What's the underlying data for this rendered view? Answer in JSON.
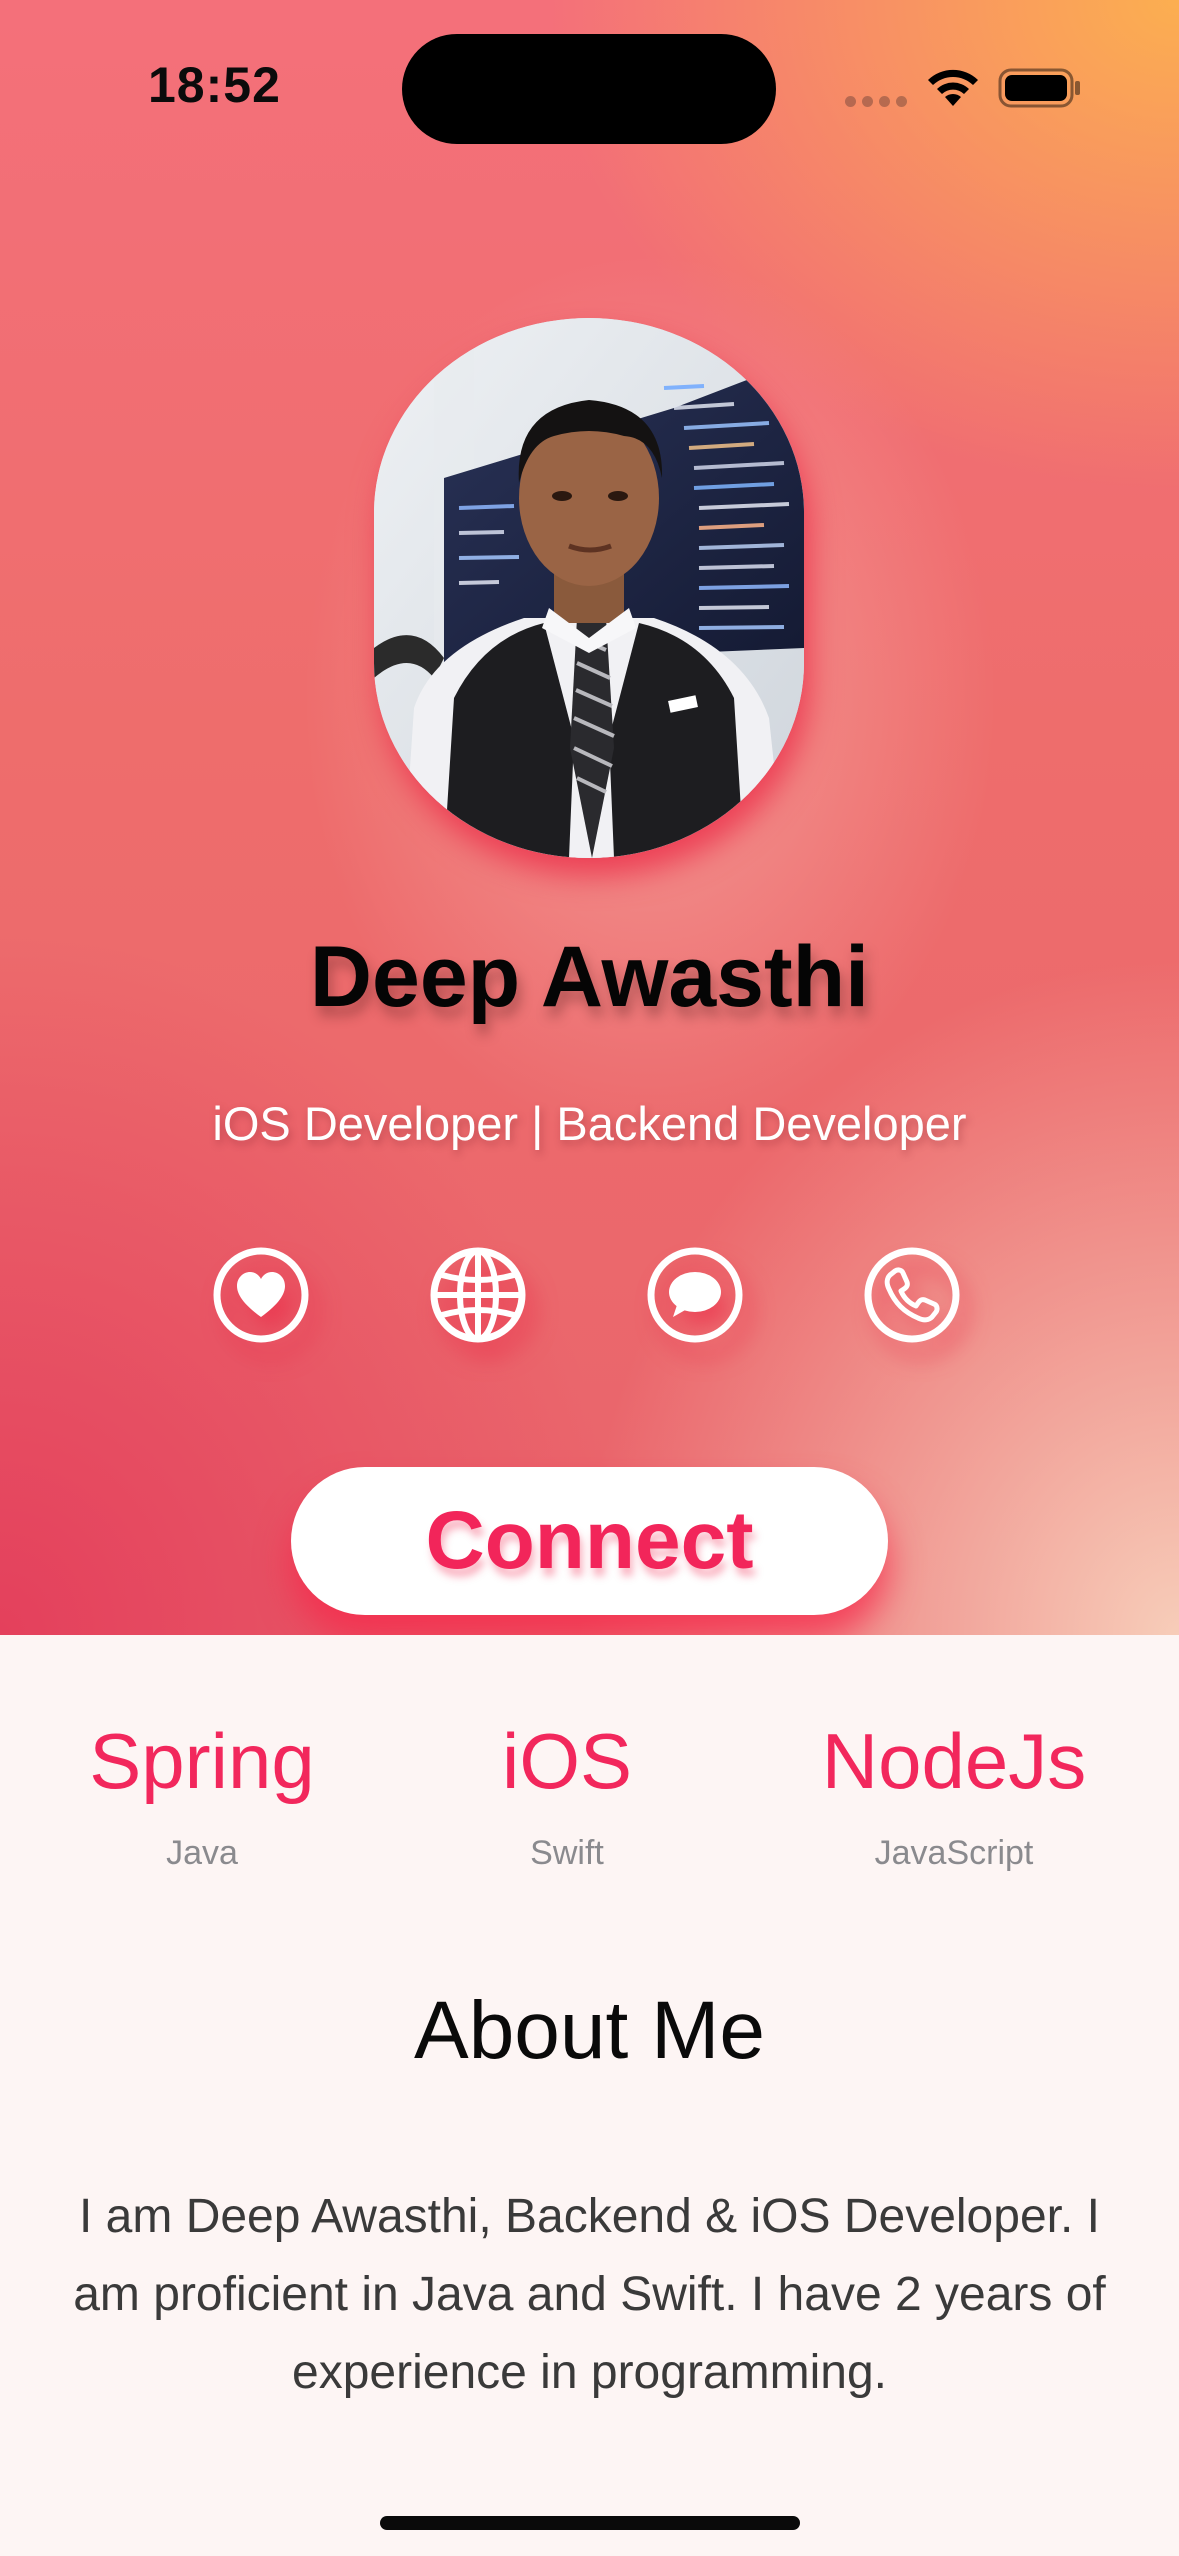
{
  "status_bar": {
    "time": "18:52"
  },
  "profile": {
    "name": "Deep Awasthi",
    "subtitle": "iOS Developer | Backend Developer"
  },
  "actions": {
    "icons": [
      "heart-icon",
      "globe-icon",
      "chat-bubble-icon",
      "phone-icon"
    ]
  },
  "connect_button": {
    "label": "Connect"
  },
  "skills": [
    {
      "name": "Spring",
      "language": "Java"
    },
    {
      "name": "iOS",
      "language": "Swift"
    },
    {
      "name": "NodeJs",
      "language": "JavaScript"
    }
  ],
  "about": {
    "title": "About Me",
    "body": "I am Deep Awasthi, Backend & iOS Developer. I am proficient in Java and Swift. I have 2 years of experience in programming."
  },
  "colors": {
    "accent": "#f2275c",
    "gradient_top_right": "#fcb24e",
    "gradient_bottom_left": "#e4405c",
    "gradient_bottom_right": "#f7cdb9",
    "page_background": "#fdf5f4"
  }
}
